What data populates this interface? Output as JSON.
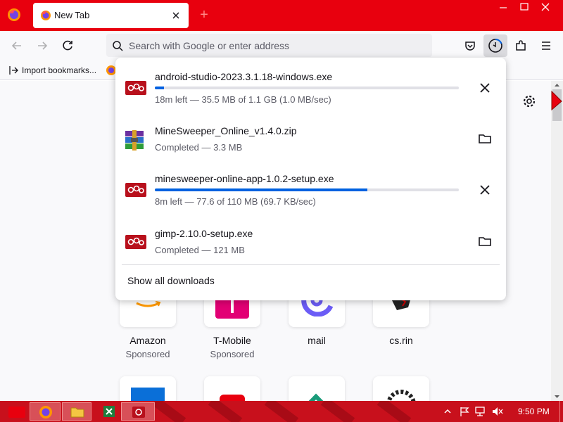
{
  "browser": {
    "tab_title": "New Tab",
    "new_tab_symbol": "+",
    "url_placeholder": "Search with Google or enter address"
  },
  "bookmarks": {
    "import_label": "Import bookmarks..."
  },
  "downloads": {
    "items": [
      {
        "name": "android-studio-2023.3.1.18-windows.exe",
        "status": "18m left — 35.5 MB of 1.1 GB (1.0 MB/sec)",
        "progress": 0.03,
        "icon": "exe-installer-icon",
        "action": "cancel"
      },
      {
        "name": "MineSweeper_Online_v1.4.0.zip",
        "status": "Completed — 3.3 MB",
        "icon": "zip-archive-icon",
        "action": "open-folder"
      },
      {
        "name": "minesweeper-online-app-1.0.2-setup.exe",
        "status": "8m left — 77.6 of 110 MB (69.7 KB/sec)",
        "progress": 0.7,
        "icon": "exe-installer-icon",
        "action": "cancel"
      },
      {
        "name": "gimp-2.10.0-setup.exe",
        "status": "Completed — 121 MB",
        "icon": "exe-installer-icon",
        "action": "open-folder"
      }
    ],
    "show_all_label": "Show all downloads"
  },
  "shortcuts": [
    {
      "label": "Amazon",
      "sub": "Sponsored"
    },
    {
      "label": "T-Mobile",
      "sub": "Sponsored"
    },
    {
      "label": "mail",
      "sub": ""
    },
    {
      "label": "cs.rin",
      "sub": ""
    }
  ],
  "taskbar": {
    "time": "9:50 PM"
  },
  "colors": {
    "accent": "#e8000e",
    "progress": "#0061e0",
    "taskbar": "#c8101c"
  }
}
